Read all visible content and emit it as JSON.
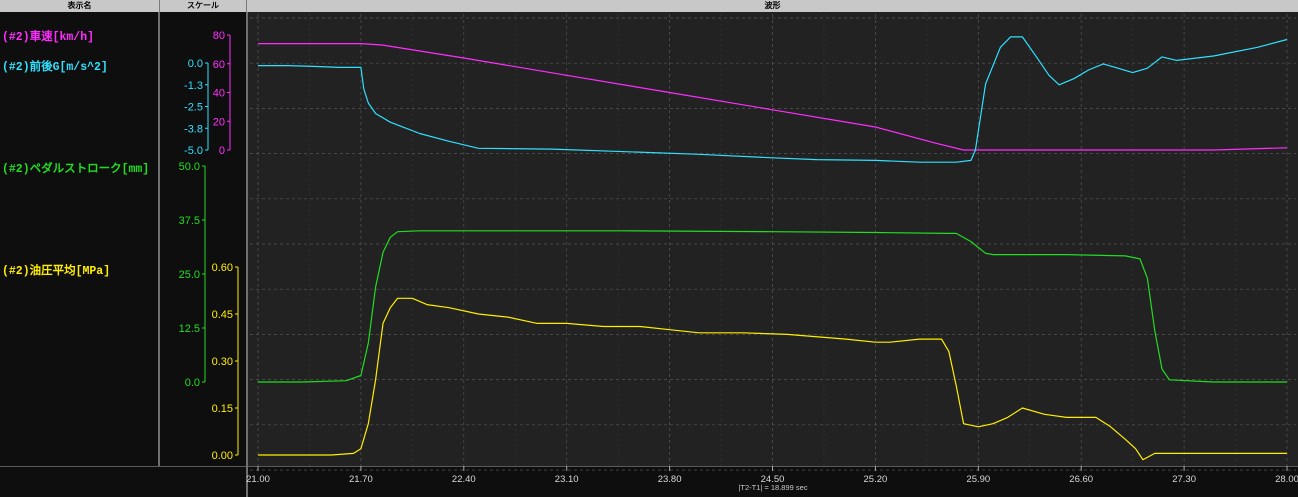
{
  "headers": {
    "name_col": "表示名",
    "scale_col": "スケール",
    "wave_col": "波形"
  },
  "channels": [
    {
      "id": "speed",
      "label": "(#2)車速[km/h]",
      "color": "#ff2dff",
      "ticks": [
        "80",
        "60",
        "40",
        "20",
        "0"
      ],
      "range": [
        0,
        80
      ]
    },
    {
      "id": "accel",
      "label": "(#2)前後G[m/s^2]",
      "color": "#30e0ff",
      "ticks": [
        "0.0",
        "-1.3",
        "-2.5",
        "-3.8",
        "-5.0"
      ],
      "range": [
        -5.0,
        0.0
      ]
    },
    {
      "id": "pedal",
      "label": "(#2)ペダルストローク[mm]",
      "color": "#22dd22",
      "ticks": [
        "50.0",
        "37.5",
        "25.0",
        "12.5",
        "0.0"
      ],
      "range": [
        0.0,
        50.0
      ]
    },
    {
      "id": "pressure",
      "label": "(#2)油圧平均[MPa]",
      "color": "#ffee00",
      "ticks": [
        "0.60",
        "0.45",
        "0.30",
        "0.15",
        "0.00"
      ],
      "range": [
        0.0,
        0.6
      ]
    }
  ],
  "time_axis": {
    "ticks": [
      "21.00",
      "21.70",
      "22.40",
      "23.10",
      "23.80",
      "24.50",
      "25.20",
      "25.90",
      "26.60",
      "27.30",
      "28.00"
    ],
    "range": [
      21.0,
      28.0
    ]
  },
  "status": {
    "delta": "|T2-T1| = 18.899  sec"
  },
  "series": {
    "speed": {
      "t": [
        21.0,
        21.7,
        21.85,
        22.4,
        23.1,
        23.8,
        24.5,
        25.2,
        25.6,
        25.8,
        25.9,
        26.2,
        27.0,
        27.5,
        28.0
      ],
      "v": [
        74,
        74,
        73,
        64,
        52,
        40,
        28,
        16,
        5,
        0,
        0,
        0,
        0,
        0,
        1.5
      ]
    },
    "accel": {
      "t": [
        21.0,
        21.2,
        21.4,
        21.55,
        21.7,
        21.72,
        21.75,
        21.8,
        21.9,
        22.1,
        22.3,
        22.5,
        23.0,
        23.5,
        24.0,
        24.5,
        24.8,
        25.2,
        25.5,
        25.75,
        25.85,
        25.88,
        25.95,
        26.05,
        26.12,
        26.2,
        26.3,
        26.38,
        26.45,
        26.55,
        26.65,
        26.75,
        26.85,
        26.95,
        27.05,
        27.15,
        27.25,
        27.5,
        27.8,
        28.0
      ],
      "v": [
        -0.15,
        -0.15,
        -0.2,
        -0.25,
        -0.25,
        -1.5,
        -2.3,
        -2.9,
        -3.4,
        -4.05,
        -4.5,
        -4.9,
        -4.95,
        -5.1,
        -5.25,
        -5.45,
        -5.55,
        -5.6,
        -5.7,
        -5.7,
        -5.6,
        -5.0,
        -1.2,
        0.9,
        1.5,
        1.5,
        0.3,
        -0.7,
        -1.25,
        -0.9,
        -0.4,
        -0.05,
        -0.3,
        -0.55,
        -0.3,
        0.35,
        0.15,
        0.4,
        0.9,
        1.35
      ]
    },
    "pedal": {
      "t": [
        21.0,
        21.3,
        21.6,
        21.7,
        21.75,
        21.8,
        21.85,
        21.9,
        21.95,
        22.1,
        22.5,
        23.5,
        24.5,
        25.2,
        25.7,
        25.75,
        25.85,
        25.95,
        26.0,
        26.5,
        26.9,
        27.0,
        27.05,
        27.1,
        27.15,
        27.2,
        27.5,
        28.0
      ],
      "v": [
        0.0,
        0.0,
        0.3,
        1.5,
        9,
        22,
        30,
        33.5,
        34.8,
        35.0,
        35.0,
        35.0,
        34.8,
        34.6,
        34.4,
        34.4,
        32.5,
        29.8,
        29.5,
        29.5,
        29.2,
        28.5,
        24,
        12,
        3,
        0.5,
        0.0,
        0.0
      ]
    },
    "pressure": {
      "t": [
        21.0,
        21.5,
        21.65,
        21.7,
        21.75,
        21.8,
        21.85,
        21.9,
        21.95,
        22.05,
        22.15,
        22.3,
        22.5,
        22.7,
        22.9,
        23.1,
        23.35,
        23.6,
        23.8,
        24.0,
        24.3,
        24.6,
        25.0,
        25.2,
        25.3,
        25.5,
        25.65,
        25.7,
        25.75,
        25.8,
        25.9,
        26.0,
        26.1,
        26.2,
        26.35,
        26.5,
        26.6,
        26.7,
        26.8,
        26.9,
        26.97,
        27.02,
        27.1,
        27.3,
        27.6,
        28.0
      ],
      "v": [
        0.0,
        0.0,
        0.005,
        0.02,
        0.1,
        0.24,
        0.42,
        0.47,
        0.5,
        0.5,
        0.48,
        0.47,
        0.45,
        0.44,
        0.42,
        0.42,
        0.41,
        0.41,
        0.4,
        0.39,
        0.39,
        0.385,
        0.37,
        0.36,
        0.36,
        0.37,
        0.37,
        0.33,
        0.22,
        0.1,
        0.09,
        0.1,
        0.12,
        0.15,
        0.13,
        0.12,
        0.12,
        0.12,
        0.09,
        0.05,
        0.02,
        -0.015,
        0.005,
        0.005,
        0.005,
        0.005
      ]
    }
  }
}
